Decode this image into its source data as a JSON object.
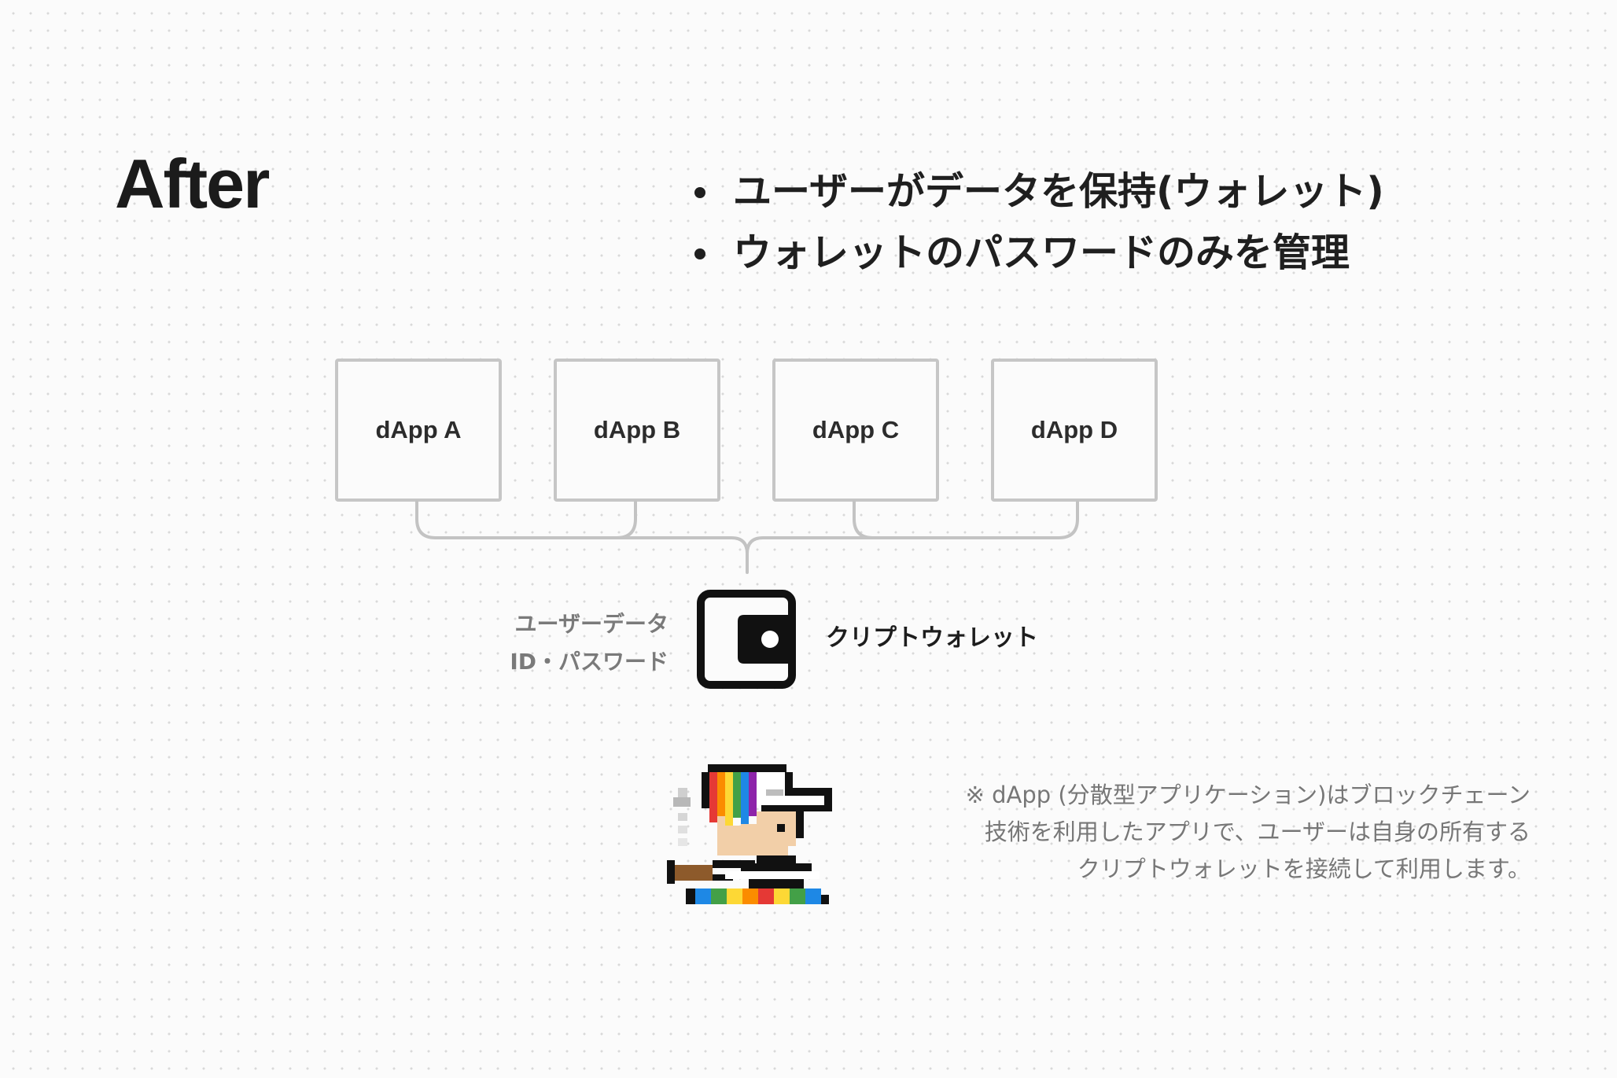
{
  "title": "After",
  "bullets": [
    "ユーザーがデータを保持(ウォレット)",
    "ウォレットのパスワードのみを管理"
  ],
  "dapps": [
    "dApp A",
    "dApp B",
    "dApp C",
    "dApp D"
  ],
  "wallet": {
    "label": "クリプトウォレット",
    "user_data_line1": "ユーザーデータ",
    "user_data_line2": "ID・パスワード",
    "icon": "wallet-icon"
  },
  "note": {
    "line1": "※ dApp (分散型アプリケーション)はブロックチェーン",
    "line2": "技術を利用したアプリで、ユーザーは自身の所有する",
    "line3": "クリプトウォレットを接続して利用します。"
  },
  "avatar": {
    "icon": "pixel-avatar-icon"
  },
  "colors": {
    "text_dark": "#1d1d1d",
    "text_muted": "#777777",
    "box_border": "#c6c6c6",
    "background": "#fbfbfb"
  }
}
